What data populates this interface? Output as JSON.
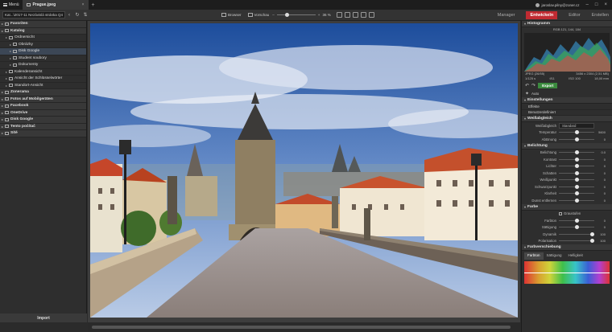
{
  "titlebar": {
    "menu_label": "Menü",
    "tab_title": "Prague.jpeg",
    "tab_close": "×",
    "new_tab": "+",
    "user_email": "jaroslav.pilny@zoner.cz"
  },
  "toolbar": {
    "path": "Kat...\\2017-11 Nezávislá stránka Q4",
    "browser_label": "Browser",
    "preview_label": "Vorschau",
    "zoom_percent": "36 %"
  },
  "modes": {
    "manager": "Manager",
    "develop": "Entwickeln",
    "editor": "Editor",
    "create": "Erstellen"
  },
  "sidebar": {
    "items": [
      {
        "label": "Favoriten",
        "bold": true,
        "indent": 0
      },
      {
        "label": "Katalog",
        "bold": true,
        "indent": 0
      },
      {
        "label": "Ordnersicht",
        "bold": false,
        "indent": 1
      },
      {
        "label": "Obrázky",
        "bold": false,
        "indent": 2
      },
      {
        "label": "Disk Google",
        "bold": false,
        "indent": 2,
        "selected": true
      },
      {
        "label": "Student soubory",
        "bold": false,
        "indent": 2
      },
      {
        "label": "Dokumenty",
        "bold": false,
        "indent": 2
      },
      {
        "label": "Kalenderansicht",
        "bold": false,
        "indent": 1
      },
      {
        "label": "Ansicht der Schlüsselwörter",
        "bold": false,
        "indent": 1
      },
      {
        "label": "Standort-Ansicht",
        "bold": false,
        "indent": 1
      },
      {
        "label": "Zonerama",
        "bold": true,
        "indent": 0
      },
      {
        "label": "Fotos auf Mobilgeräten",
        "bold": true,
        "indent": 0
      },
      {
        "label": "Facebook",
        "bold": true,
        "indent": 0
      },
      {
        "label": "OneDrive",
        "bold": true,
        "indent": 0
      },
      {
        "label": "Disk Google",
        "bold": true,
        "indent": 0
      },
      {
        "label": "Tento počítač",
        "bold": true,
        "indent": 0
      },
      {
        "label": "Sítě",
        "bold": true,
        "indent": 0
      }
    ],
    "import_label": "Import"
  },
  "right_panel": {
    "histogram_title": "Histogramm",
    "rgb_readout": "RGB 121, 144, 184",
    "file_type": "JPEG",
    "file_index": "(26/55)",
    "dimensions": "3456 x 2304 (2,51 MB)",
    "exposure": "1/125 s",
    "aperture": "f/11",
    "iso": "ISO 100",
    "focal": "18,00 mm",
    "auto_label": "Auto",
    "export_label": "Export",
    "settings_title": "Einstellungen",
    "effects_label": "Effekte",
    "user_defined_label": "Benutzerdefiniert",
    "wb_title": "Weißabgleich",
    "wb_mode_label": "Weißabgleich",
    "wb_mode_value": "Standard",
    "temperature_label": "Temperatur",
    "temperature_value": "5600",
    "tint_label": "Abtönung",
    "tint_value": "0",
    "exposure_title": "Belichtung",
    "exposure_rows": [
      {
        "label": "Belichtung",
        "value": "0.0"
      },
      {
        "label": "Kontrast",
        "value": "0"
      },
      {
        "label": "Lichter",
        "value": "0"
      },
      {
        "label": "Schatten",
        "value": "0"
      },
      {
        "label": "Weißpunkt",
        "value": "0"
      },
      {
        "label": "Schwarzpunkt",
        "value": "0"
      },
      {
        "label": "Klarheit",
        "value": "0"
      },
      {
        "label": "Dunst entfernen",
        "value": "0"
      }
    ],
    "color_title": "Farbe",
    "grayscale_label": "Graustufen",
    "color_rows": [
      {
        "label": "Farbton",
        "value": "0"
      },
      {
        "label": "Sättigung",
        "value": "0"
      },
      {
        "label": "Dynamik",
        "value": "100"
      },
      {
        "label": "Polarisation",
        "value": "100"
      }
    ],
    "color_shift_title": "Farbverschiebung",
    "shift_tabs": [
      "Farbton",
      "Sättigung",
      "Helligkeit"
    ]
  }
}
